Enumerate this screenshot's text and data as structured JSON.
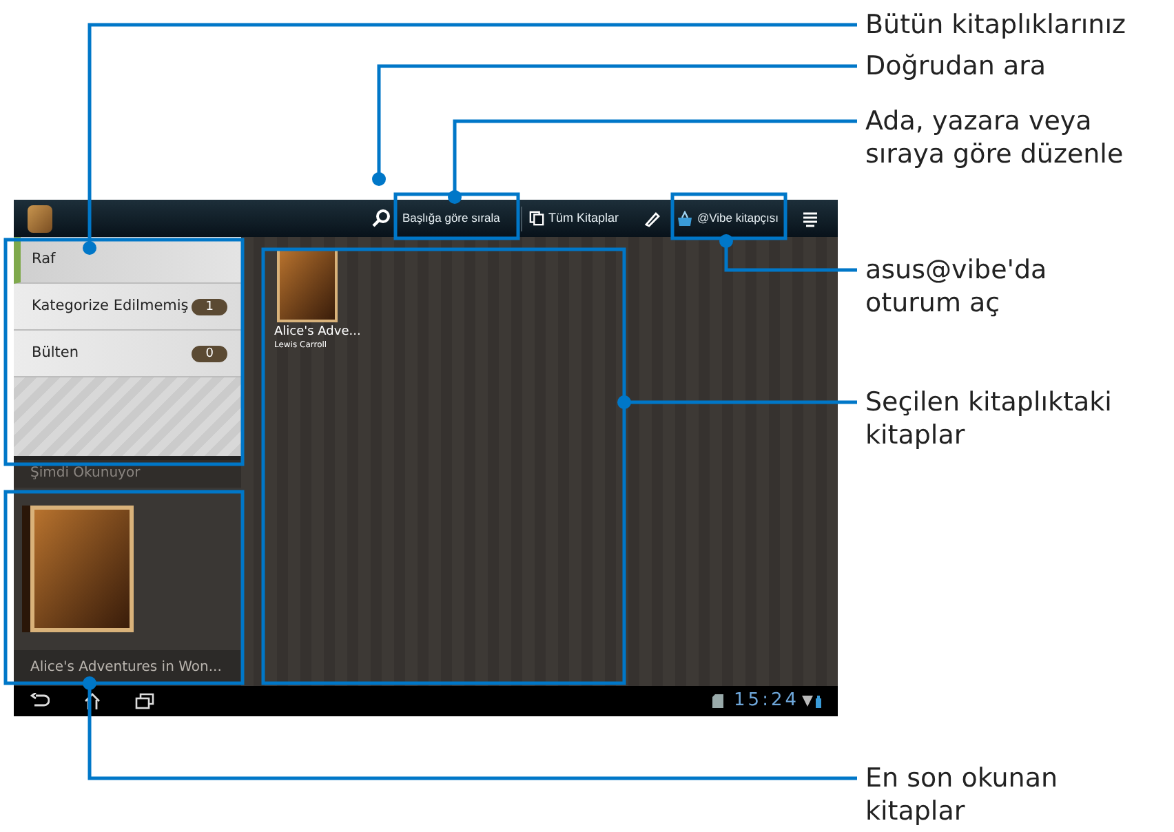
{
  "toolbar": {
    "sort": "Başlığa göre sırala",
    "all_books": "Tüm Kitaplar",
    "store": "@Vibe kitapçısı"
  },
  "shelves": [
    {
      "label": "Raf",
      "selected": true
    },
    {
      "label": "Kategorize Edilmemiş",
      "count": "1",
      "selected": false
    },
    {
      "label": "Bülten",
      "count": "0",
      "selected": false
    }
  ],
  "now_reading": {
    "heading": "Şimdi Okunuyor",
    "title": "Alice's Adventures in Won..."
  },
  "books": [
    {
      "title": "Alice's Adve...",
      "author": "Lewis Carroll"
    }
  ],
  "status_bar": {
    "time": "15:24"
  },
  "callouts": [
    {
      "text": "Bütün kitaplıklarınız"
    },
    {
      "text": "Doğrudan ara"
    },
    {
      "text": "Ada, yazara veya\nsıraya göre düzenle"
    },
    {
      "text": "asus@vibe'da\noturum aç"
    },
    {
      "text": "Seçilen kitaplıktaki\nkitaplar"
    },
    {
      "text": "En son okunan\nkitaplar"
    }
  ]
}
